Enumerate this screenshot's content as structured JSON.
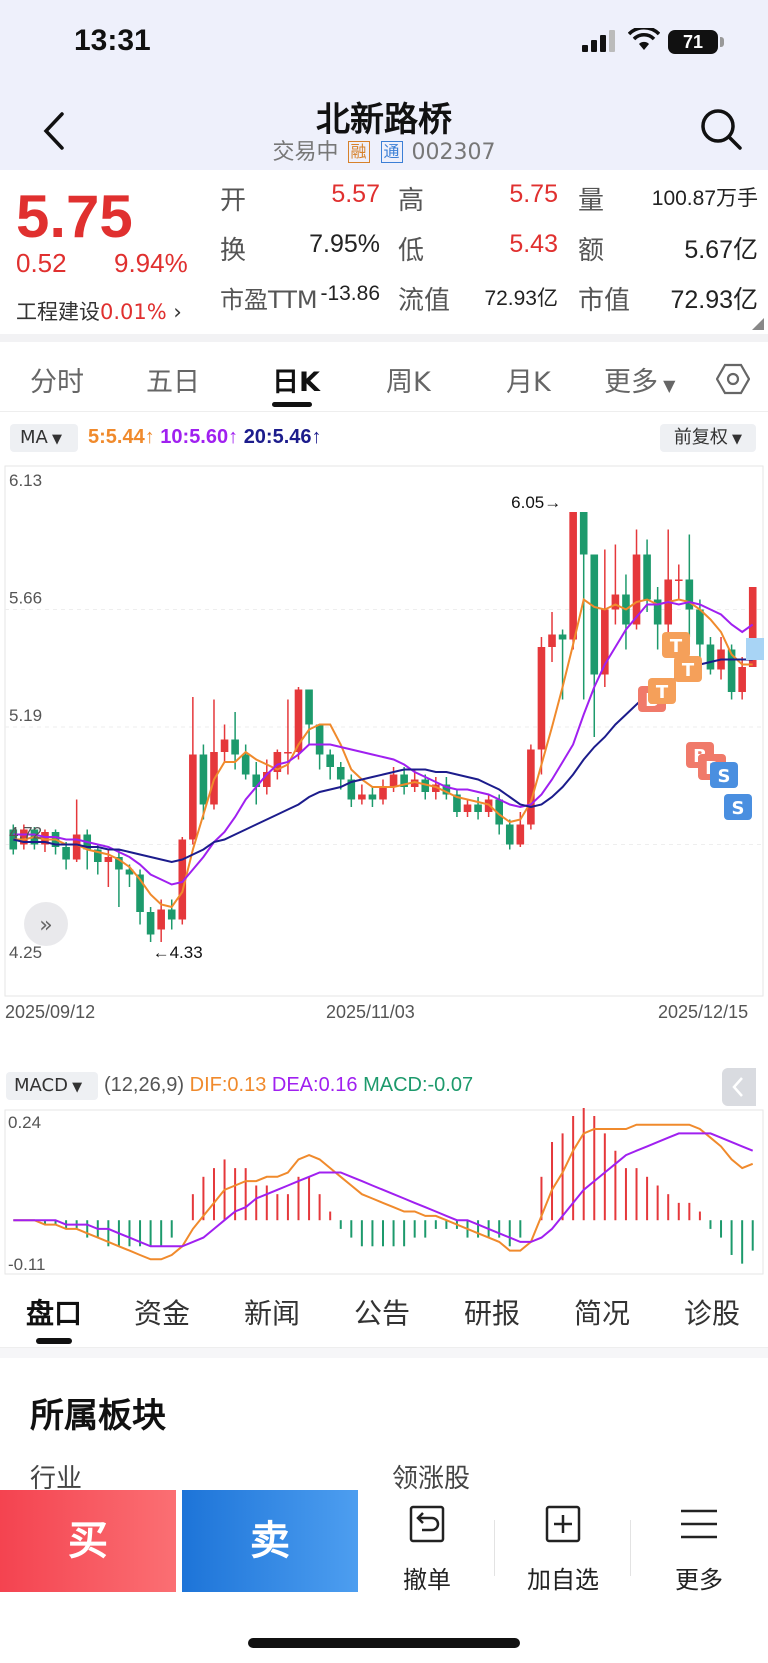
{
  "status_bar": {
    "time": "13:31",
    "battery": "71"
  },
  "header": {
    "stock_name": "北新路桥",
    "status": "交易中",
    "tag_rong": "融",
    "tag_tong": "通",
    "code": "002307"
  },
  "quote": {
    "price": "5.75",
    "change": "0.52",
    "change_pct": "9.94%",
    "sector": "工程建设",
    "sector_pct": "0.01%",
    "fields": [
      {
        "label": "开",
        "value": "5.57"
      },
      {
        "label": "高",
        "value": "5.75"
      },
      {
        "label": "量",
        "value": "100.87万手"
      },
      {
        "label": "换",
        "value": "7.95%"
      },
      {
        "label": "低",
        "value": "5.43"
      },
      {
        "label": "额",
        "value": "5.67亿"
      },
      {
        "label": "市盈TTM",
        "value": "-13.86"
      },
      {
        "label": "流值",
        "value": "72.93亿"
      },
      {
        "label": "市值",
        "value": "72.93亿"
      }
    ]
  },
  "period_tabs": [
    "分时",
    "五日",
    "日K",
    "周K",
    "月K",
    "更多"
  ],
  "ma": {
    "button": "MA",
    "ma5": "5:5.44",
    "ma10": "10:5.60",
    "ma20": "20:5.46",
    "adjust": "前复权"
  },
  "chart_data": {
    "type": "candlestick",
    "y_ticks": [
      "6.13",
      "5.66",
      "5.19",
      "4.72",
      "4.25"
    ],
    "x_ticks": [
      "2025/09/12",
      "2025/11/03",
      "2025/12/15"
    ],
    "high_marker": "6.05",
    "low_marker": "4.33",
    "ylim": [
      4.25,
      6.13
    ],
    "colors": {
      "up": "#e5383b",
      "down": "#1d9a6c",
      "ma5": "#f08a2c",
      "ma10": "#a020f0",
      "ma20": "#1c1c8c"
    },
    "candles": [
      [
        4.78,
        4.7,
        4.8,
        4.68
      ],
      [
        4.72,
        4.78,
        4.8,
        4.7
      ],
      [
        4.78,
        4.72,
        4.79,
        4.7
      ],
      [
        4.72,
        4.77,
        4.78,
        4.69
      ],
      [
        4.77,
        4.71,
        4.78,
        4.68
      ],
      [
        4.71,
        4.66,
        4.73,
        4.62
      ],
      [
        4.66,
        4.76,
        4.9,
        4.65
      ],
      [
        4.76,
        4.7,
        4.78,
        4.62
      ],
      [
        4.7,
        4.65,
        4.72,
        4.6
      ],
      [
        4.65,
        4.67,
        4.7,
        4.55
      ],
      [
        4.67,
        4.62,
        4.7,
        4.47
      ],
      [
        4.62,
        4.6,
        4.64,
        4.55
      ],
      [
        4.6,
        4.45,
        4.62,
        4.4
      ],
      [
        4.45,
        4.36,
        4.47,
        4.33
      ],
      [
        4.38,
        4.46,
        4.5,
        4.33
      ],
      [
        4.46,
        4.42,
        4.5,
        4.38
      ],
      [
        4.42,
        4.74,
        4.75,
        4.4
      ],
      [
        4.74,
        5.08,
        5.31,
        4.72
      ],
      [
        5.08,
        4.88,
        5.12,
        4.82
      ],
      [
        4.88,
        5.09,
        5.3,
        4.86
      ],
      [
        5.09,
        5.14,
        5.2,
        5.05
      ],
      [
        5.14,
        5.08,
        5.25,
        5.02
      ],
      [
        5.08,
        5.0,
        5.12,
        4.98
      ],
      [
        5.0,
        4.95,
        5.05,
        4.88
      ],
      [
        4.95,
        5.01,
        5.06,
        4.92
      ],
      [
        5.01,
        5.09,
        5.1,
        4.98
      ],
      [
        5.09,
        5.09,
        5.3,
        5.0
      ],
      [
        5.09,
        5.34,
        5.35,
        5.06
      ],
      [
        5.34,
        5.2,
        5.26,
        5.12
      ],
      [
        5.2,
        5.08,
        5.13,
        5.02
      ],
      [
        5.08,
        5.03,
        5.1,
        4.98
      ],
      [
        5.03,
        4.98,
        5.05,
        4.94
      ],
      [
        4.98,
        4.9,
        5.0,
        4.87
      ],
      [
        4.9,
        4.92,
        4.96,
        4.88
      ],
      [
        4.92,
        4.9,
        4.95,
        4.87
      ],
      [
        4.9,
        4.95,
        4.98,
        4.88
      ],
      [
        4.95,
        5.0,
        5.03,
        4.93
      ],
      [
        5.0,
        4.95,
        5.03,
        4.92
      ],
      [
        4.95,
        4.98,
        5.02,
        4.93
      ],
      [
        4.98,
        4.93,
        5.0,
        4.9
      ],
      [
        4.93,
        4.96,
        4.99,
        4.9
      ],
      [
        4.96,
        4.92,
        4.99,
        4.9
      ],
      [
        4.92,
        4.85,
        4.94,
        4.83
      ],
      [
        4.85,
        4.88,
        4.9,
        4.83
      ],
      [
        4.88,
        4.85,
        4.91,
        4.82
      ],
      [
        4.85,
        4.9,
        4.92,
        4.83
      ],
      [
        4.9,
        4.8,
        4.92,
        4.76
      ],
      [
        4.8,
        4.72,
        4.82,
        4.7
      ],
      [
        4.72,
        4.8,
        4.85,
        4.71
      ],
      [
        4.8,
        5.1,
        5.12,
        4.78
      ],
      [
        5.1,
        5.51,
        5.55,
        5.0
      ],
      [
        5.51,
        5.56,
        5.65,
        5.45
      ],
      [
        5.56,
        5.54,
        5.58,
        5.3
      ],
      [
        5.54,
        6.05,
        6.05,
        5.5
      ],
      [
        6.05,
        5.88,
        6.0,
        5.3
      ],
      [
        5.88,
        5.4,
        5.72,
        5.15
      ],
      [
        5.4,
        5.66,
        5.9,
        5.35
      ],
      [
        5.66,
        5.72,
        5.92,
        5.6
      ],
      [
        5.72,
        5.6,
        5.8,
        5.5
      ],
      [
        5.6,
        5.88,
        5.98,
        5.58
      ],
      [
        5.88,
        5.7,
        5.94,
        5.65
      ],
      [
        5.7,
        5.6,
        5.75,
        5.5
      ],
      [
        5.6,
        5.78,
        5.98,
        5.55
      ],
      [
        5.78,
        5.78,
        5.84,
        5.7
      ],
      [
        5.78,
        5.66,
        5.96,
        5.55
      ],
      [
        5.66,
        5.52,
        5.7,
        5.45
      ],
      [
        5.52,
        5.42,
        5.55,
        5.4
      ],
      [
        5.42,
        5.5,
        5.55,
        5.38
      ],
      [
        5.5,
        5.33,
        5.52,
        5.3
      ],
      [
        5.33,
        5.43,
        5.47,
        5.3
      ],
      [
        5.43,
        5.75,
        5.75,
        5.43
      ]
    ],
    "ma5": [
      4.74,
      4.74,
      4.75,
      4.74,
      4.74,
      4.72,
      4.72,
      4.7,
      4.69,
      4.68,
      4.66,
      4.63,
      4.58,
      4.52,
      4.48,
      4.47,
      4.53,
      4.7,
      4.84,
      4.98,
      5.05,
      5.05,
      5.09,
      5.06,
      5.04,
      5.02,
      5.04,
      5.12,
      5.18,
      5.2,
      5.2,
      5.12,
      5.02,
      4.98,
      4.95,
      4.95,
      4.95,
      4.96,
      4.97,
      4.96,
      4.95,
      4.93,
      4.91,
      4.9,
      4.89,
      4.88,
      4.84,
      4.81,
      4.82,
      4.89,
      5.04,
      5.19,
      5.35,
      5.52,
      5.7,
      5.67,
      5.66,
      5.68,
      5.66,
      5.69,
      5.7,
      5.68,
      5.69,
      5.7,
      5.69,
      5.66,
      5.62,
      5.57,
      5.48,
      5.44,
      5.44
    ],
    "ma10": [
      4.76,
      4.76,
      4.76,
      4.75,
      4.75,
      4.74,
      4.74,
      4.73,
      4.72,
      4.71,
      4.69,
      4.67,
      4.64,
      4.6,
      4.58,
      4.56,
      4.57,
      4.62,
      4.67,
      4.73,
      4.77,
      4.83,
      4.9,
      4.95,
      5.0,
      5.04,
      5.05,
      5.08,
      5.12,
      5.12,
      5.12,
      5.11,
      5.1,
      5.09,
      5.08,
      5.07,
      5.06,
      5.04,
      5.01,
      4.99,
      4.97,
      4.95,
      4.94,
      4.94,
      4.93,
      4.92,
      4.9,
      4.88,
      4.87,
      4.88,
      4.92,
      4.98,
      5.05,
      5.12,
      5.24,
      5.35,
      5.44,
      5.51,
      5.58,
      5.63,
      5.68,
      5.68,
      5.69,
      5.68,
      5.69,
      5.68,
      5.66,
      5.64,
      5.6,
      5.57,
      5.6
    ],
    "ma20": [
      4.74,
      4.73,
      4.73,
      4.73,
      4.72,
      4.72,
      4.72,
      4.71,
      4.71,
      4.7,
      4.7,
      4.69,
      4.68,
      4.67,
      4.66,
      4.65,
      4.66,
      4.68,
      4.7,
      4.73,
      4.74,
      4.76,
      4.78,
      4.8,
      4.82,
      4.84,
      4.86,
      4.88,
      4.91,
      4.93,
      4.94,
      4.95,
      4.97,
      4.98,
      4.99,
      5.0,
      5.01,
      5.02,
      5.02,
      5.02,
      5.01,
      5.01,
      5.0,
      4.99,
      4.98,
      4.96,
      4.94,
      4.91,
      4.88,
      4.87,
      4.88,
      4.91,
      4.95,
      5.0,
      5.06,
      5.11,
      5.15,
      5.2,
      5.24,
      5.28,
      5.32,
      5.34,
      5.37,
      5.39,
      5.42,
      5.44,
      5.45,
      5.46,
      5.46,
      5.46,
      5.46
    ]
  },
  "macd": {
    "button": "MACD",
    "params": "(12,26,9)",
    "dif": "DIF:0.13",
    "dea": "DEA:0.16",
    "macd": "MACD:-0.07",
    "y_top": "0.24",
    "y_bottom": "-0.11",
    "range": [
      -0.11,
      0.24
    ],
    "dif_series": [
      0.0,
      0.0,
      0.0,
      -0.01,
      -0.01,
      -0.02,
      -0.02,
      -0.03,
      -0.04,
      -0.05,
      -0.06,
      -0.07,
      -0.08,
      -0.09,
      -0.09,
      -0.08,
      -0.06,
      -0.02,
      0.01,
      0.04,
      0.07,
      0.08,
      0.09,
      0.09,
      0.1,
      0.1,
      0.11,
      0.14,
      0.15,
      0.14,
      0.12,
      0.1,
      0.08,
      0.06,
      0.05,
      0.04,
      0.03,
      0.02,
      0.02,
      0.01,
      0.01,
      0.0,
      -0.01,
      -0.02,
      -0.03,
      -0.04,
      -0.05,
      -0.07,
      -0.07,
      -0.05,
      0.01,
      0.07,
      0.11,
      0.16,
      0.2,
      0.21,
      0.21,
      0.21,
      0.21,
      0.22,
      0.22,
      0.22,
      0.22,
      0.22,
      0.22,
      0.21,
      0.19,
      0.17,
      0.14,
      0.12,
      0.13
    ],
    "dea_series": [
      0.0,
      0.0,
      0.0,
      0.0,
      0.0,
      -0.01,
      -0.01,
      -0.01,
      -0.02,
      -0.02,
      -0.03,
      -0.04,
      -0.05,
      -0.06,
      -0.06,
      -0.06,
      -0.06,
      -0.05,
      -0.04,
      -0.02,
      0.0,
      0.02,
      0.03,
      0.05,
      0.06,
      0.07,
      0.08,
      0.09,
      0.1,
      0.11,
      0.11,
      0.11,
      0.1,
      0.09,
      0.08,
      0.07,
      0.06,
      0.05,
      0.04,
      0.03,
      0.02,
      0.01,
      0.0,
      0.0,
      -0.01,
      -0.02,
      -0.03,
      -0.04,
      -0.05,
      -0.05,
      -0.04,
      -0.02,
      0.01,
      0.04,
      0.07,
      0.09,
      0.11,
      0.13,
      0.15,
      0.16,
      0.17,
      0.18,
      0.19,
      0.2,
      0.2,
      0.2,
      0.2,
      0.19,
      0.18,
      0.17,
      0.16
    ],
    "hist": [
      0.0,
      0.0,
      0.0,
      -0.01,
      -0.01,
      -0.02,
      -0.02,
      -0.04,
      -0.04,
      -0.06,
      -0.06,
      -0.06,
      -0.06,
      -0.06,
      -0.06,
      -0.04,
      0.0,
      0.06,
      0.1,
      0.12,
      0.14,
      0.12,
      0.12,
      0.08,
      0.08,
      0.06,
      0.06,
      0.1,
      0.1,
      0.06,
      0.02,
      -0.02,
      -0.04,
      -0.06,
      -0.06,
      -0.06,
      -0.06,
      -0.06,
      -0.04,
      -0.04,
      -0.02,
      -0.02,
      -0.02,
      -0.04,
      -0.04,
      -0.04,
      -0.04,
      -0.06,
      -0.04,
      0.0,
      0.1,
      0.18,
      0.2,
      0.24,
      0.26,
      0.24,
      0.2,
      0.16,
      0.12,
      0.12,
      0.1,
      0.08,
      0.06,
      0.04,
      0.04,
      0.02,
      -0.02,
      -0.04,
      -0.08,
      -0.1,
      -0.07
    ]
  },
  "info_tabs": [
    "盘口",
    "资金",
    "新闻",
    "公告",
    "研报",
    "简况",
    "诊股"
  ],
  "section": {
    "title": "所属板块",
    "left": "行业",
    "right": "领涨股"
  },
  "bottom": {
    "buy": "买",
    "sell": "卖",
    "cancel": "撤单",
    "watch": "加自选",
    "more": "更多"
  }
}
